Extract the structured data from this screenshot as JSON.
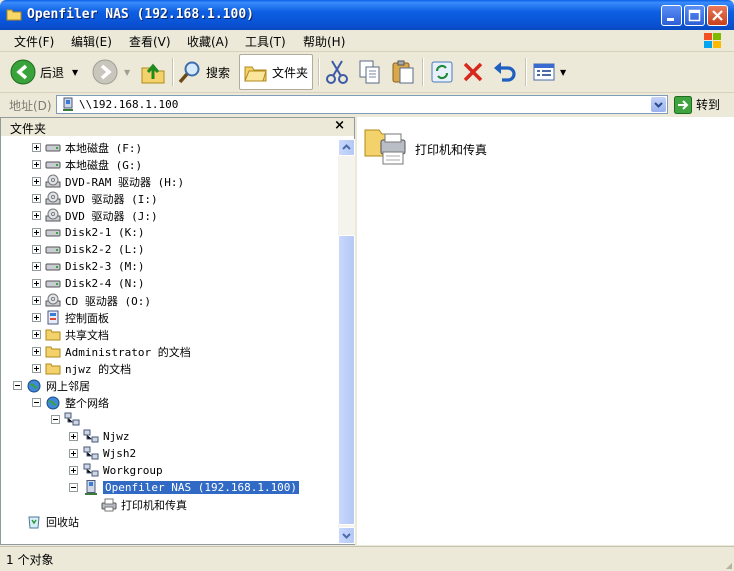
{
  "window": {
    "title": "Openfiler NAS (192.168.1.100)"
  },
  "menu": [
    "文件(F)",
    "编辑(E)",
    "查看(V)",
    "收藏(A)",
    "工具(T)",
    "帮助(H)"
  ],
  "toolbar": {
    "back": "后退",
    "search": "搜索",
    "folders": "文件夹"
  },
  "address": {
    "label": "地址(D)",
    "value": "\\\\192.168.1.100",
    "go": "转到"
  },
  "folder_pane": {
    "title": "文件夹",
    "close": "×",
    "items": [
      "本地磁盘 (F:)",
      "本地磁盘 (G:)",
      "DVD-RAM 驱动器 (H:)",
      "DVD 驱动器 (I:)",
      "DVD 驱动器 (J:)",
      "Disk2-1 (K:)",
      "Disk2-2 (L:)",
      "Disk2-3 (M:)",
      "Disk2-4 (N:)",
      "CD 驱动器 (O:)",
      "控制面板",
      "共享文档",
      "Administrator 的文档",
      "njwz 的文档",
      "网上邻居",
      "整个网络",
      "",
      "Njwz",
      "Wjsh2",
      "Workgroup",
      "Openfiler NAS (192.168.1.100)",
      "打印机和传真",
      "回收站"
    ]
  },
  "content": {
    "item": "打印机和传真"
  },
  "status": {
    "text": "1 个对象"
  }
}
